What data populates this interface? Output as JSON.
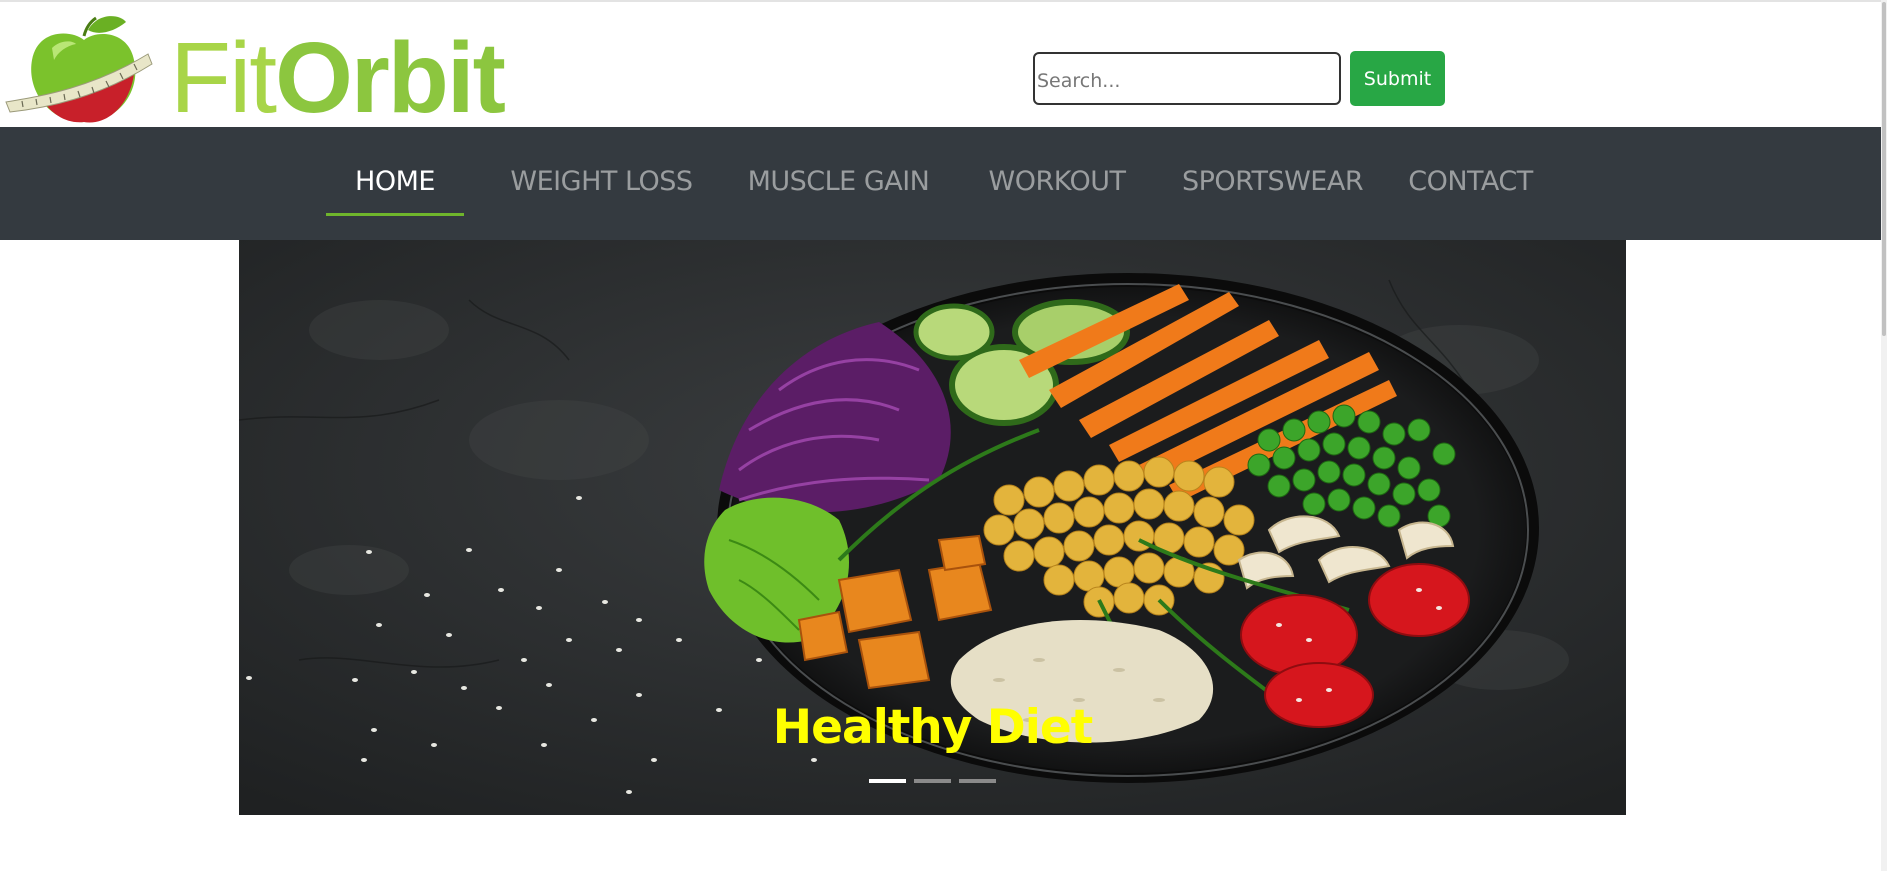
{
  "header": {
    "logo_text_fit": "Fit",
    "logo_text_orbit": "Orbit",
    "search": {
      "placeholder": "Search...",
      "value": ""
    },
    "submit_label": "Submit"
  },
  "nav": {
    "items": [
      {
        "label": "HOME",
        "active": true
      },
      {
        "label": "WEIGHT LOSS",
        "active": false
      },
      {
        "label": "MUSCLE GAIN",
        "active": false
      },
      {
        "label": "WORKOUT",
        "active": false
      },
      {
        "label": "SPORTSWEAR",
        "active": false
      },
      {
        "label": "CONTACT",
        "active": false
      }
    ]
  },
  "carousel": {
    "caption": "Healthy Diet",
    "slide_count": 3,
    "active_slide": 1
  },
  "colors": {
    "brand_green": "#8cc63f",
    "submit_green": "#28a745",
    "nav_bg": "#343a40",
    "nav_active_underline": "#6fb52c",
    "caption_yellow": "#ffff00"
  },
  "icons": {
    "logo": "apple-measuring-tape-icon"
  }
}
